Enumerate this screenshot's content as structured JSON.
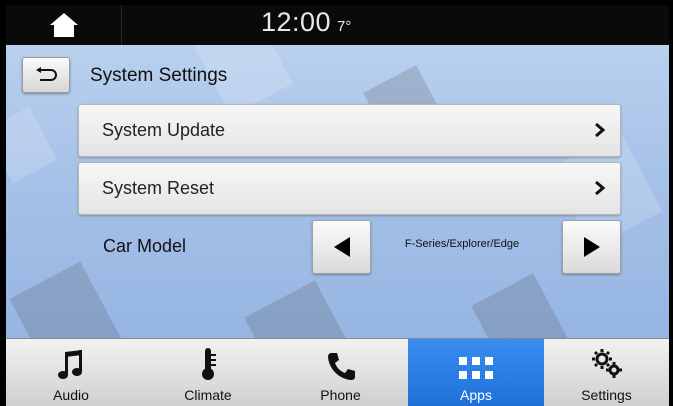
{
  "status_bar": {
    "home_icon": "home-icon",
    "time": "12:00",
    "temperature": "7°"
  },
  "header": {
    "back_icon": "back-arrow-icon",
    "title": "System Settings"
  },
  "menu": {
    "items": [
      {
        "label": "System Update",
        "icon": "chevron-right-icon"
      },
      {
        "label": "System Reset",
        "icon": "chevron-right-icon"
      }
    ]
  },
  "car_model": {
    "label": "Car Model",
    "value": "F-Series/Explorer/Edge",
    "prev_icon": "triangle-left-icon",
    "next_icon": "triangle-right-icon"
  },
  "nav": {
    "items": [
      {
        "label": "Audio",
        "icon": "music-note-icon"
      },
      {
        "label": "Climate",
        "icon": "thermometer-icon"
      },
      {
        "label": "Phone",
        "icon": "phone-icon"
      },
      {
        "label": "Apps",
        "icon": "grid-icon",
        "active": true
      },
      {
        "label": "Settings",
        "icon": "gears-icon"
      }
    ],
    "active_color": "#2a7ee6"
  }
}
